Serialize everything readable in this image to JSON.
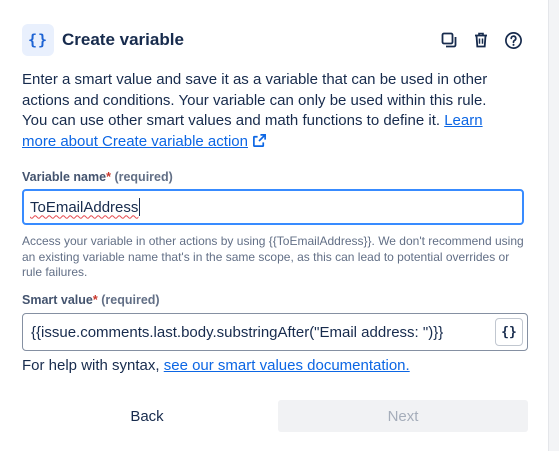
{
  "header": {
    "icon": "curly-braces-icon",
    "title": "Create variable",
    "actions": [
      "duplicate-icon",
      "trash-icon",
      "help-icon"
    ]
  },
  "description": {
    "text": "Enter a smart value and save it as a variable that can be used in other actions and conditions. Your variable can only be used within this rule. You can use other smart values and math functions to define it.",
    "link": "Learn more about Create variable action"
  },
  "variable_name": {
    "label": "Variable name",
    "required_mark": "*",
    "required_text": "(required)",
    "value": "ToEmailAddress",
    "help": "Access your variable in other actions by using {{ToEmailAddress}}. We don't recommend using an existing variable name that's in the same scope, as this can lead to potential overrides or rule failures."
  },
  "smart_value": {
    "label": "Smart value",
    "required_mark": "*",
    "required_text": "(required)",
    "value": "{{issue.comments.last.body.substringAfter(\"Email address: \")}}",
    "button_glyph": "{}"
  },
  "syntax_help": {
    "prefix": "For help with syntax,",
    "link": "see our smart values documentation."
  },
  "footer": {
    "back_label": "Back",
    "next_label": "Next"
  },
  "colors": {
    "link": "#0c66e4",
    "focus_border": "#388bff",
    "required": "#c9372c",
    "icon_bg": "#e9f0fd"
  }
}
